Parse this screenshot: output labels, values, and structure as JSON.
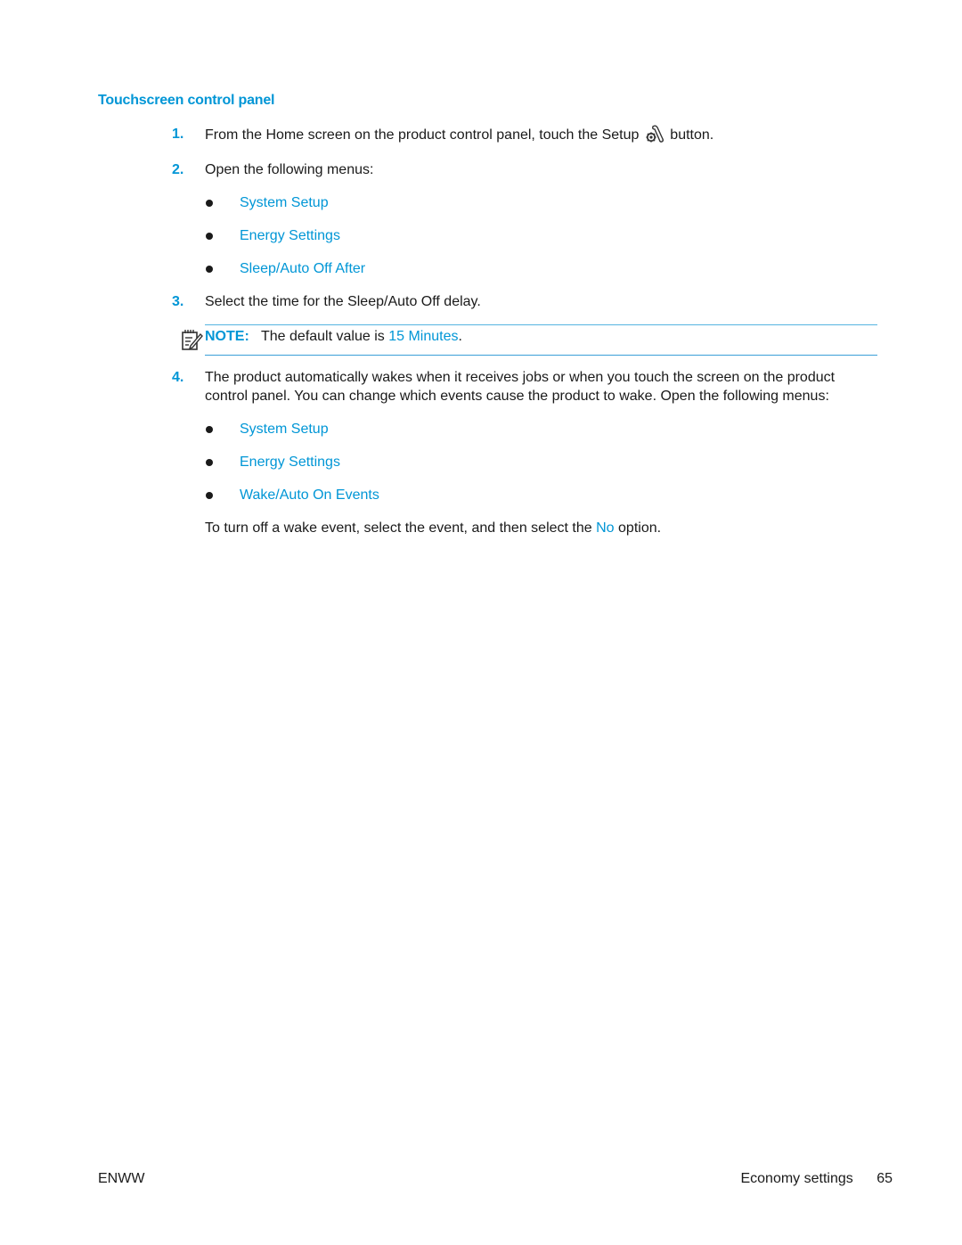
{
  "section": {
    "heading": "Touchscreen control panel"
  },
  "steps": [
    {
      "number": "1.",
      "text_before": "From the Home screen on the product control panel, touch the Setup",
      "icon": "setup-wrench-gear-icon",
      "text_after": "button."
    },
    {
      "number": "2.",
      "text": "Open the following menus:",
      "menus": [
        "System Setup",
        "Energy Settings",
        "Sleep/Auto Off After"
      ]
    },
    {
      "number": "3.",
      "text": "Select the time for the Sleep/Auto Off delay."
    },
    {
      "number": "4.",
      "text": "The product automatically wakes when it receives jobs or when you touch the screen on the product control panel. You can change which events cause the product to wake. Open the following menus:",
      "menus": [
        "System Setup",
        "Energy Settings",
        "Wake/Auto On Events"
      ]
    }
  ],
  "note": {
    "icon": "note-pencil-icon",
    "label": "NOTE:",
    "text_before": "The default value is",
    "value": "15 Minutes",
    "text_after": "."
  },
  "final_paragraph": {
    "text_before": "To turn off a wake event, select the event, and then select the",
    "option": "No",
    "text_after": "option."
  },
  "footer": {
    "left": "ENWW",
    "section_name": "Economy settings",
    "page_number": "65"
  },
  "colors": {
    "accent": "#0096d6",
    "text": "#1a1a1a",
    "note_rule": "#56b4e0"
  }
}
